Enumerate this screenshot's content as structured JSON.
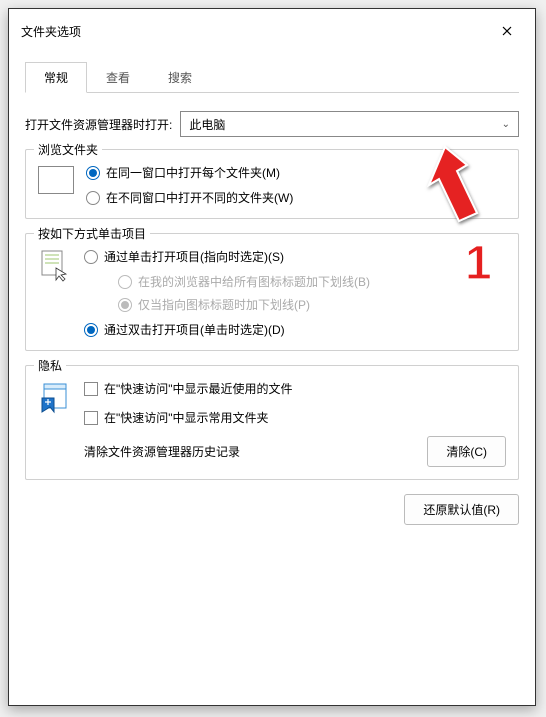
{
  "window": {
    "title": "文件夹选项"
  },
  "tabs": [
    {
      "label": "常规",
      "active": true
    },
    {
      "label": "查看",
      "active": false
    },
    {
      "label": "搜索",
      "active": false
    }
  ],
  "openWith": {
    "label": "打开文件资源管理器时打开:",
    "value": "此电脑"
  },
  "browse": {
    "title": "浏览文件夹",
    "opt1": "在同一窗口中打开每个文件夹(M)",
    "opt2": "在不同窗口中打开不同的文件夹(W)"
  },
  "click": {
    "title": "按如下方式单击项目",
    "opt1": "通过单击打开项目(指向时选定)(S)",
    "sub1": "在我的浏览器中给所有图标标题加下划线(B)",
    "sub2": "仅当指向图标标题时加下划线(P)",
    "opt2": "通过双击打开项目(单击时选定)(D)"
  },
  "privacy": {
    "title": "隐私",
    "chk1": "在\"快速访问\"中显示最近使用的文件",
    "chk2": "在\"快速访问\"中显示常用文件夹",
    "clearLabel": "清除文件资源管理器历史记录",
    "clearBtn": "清除(C)"
  },
  "restoreBtn": "还原默认值(R)",
  "annotation": {
    "num": "1"
  }
}
